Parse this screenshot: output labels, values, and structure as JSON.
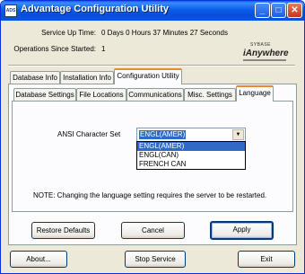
{
  "window": {
    "title": "Advantage Configuration Utility",
    "icon_text": "ADS",
    "controls": {
      "minimize": "_",
      "maximize": "□",
      "close": "✕"
    }
  },
  "status": {
    "uptime_label": "Service Up Time:",
    "uptime_value": "0 Days 0 Hours 37 Minutes 27 Seconds",
    "ops_label": "Operations Since Started:",
    "ops_value": "1"
  },
  "logo": {
    "small": "SYBASE",
    "big": "iAnywhere"
  },
  "main_tabs": [
    "Database Info",
    "Installation Info",
    "Configuration Utility"
  ],
  "sub_tabs": [
    "Database Settings",
    "File Locations",
    "Communications",
    "Misc. Settings",
    "Language"
  ],
  "language": {
    "field_label": "ANSI Character Set",
    "selected": "ENGL(AMER)",
    "options": [
      "ENGL(AMER)",
      "ENGL(CAN)",
      "FRENCH CAN"
    ],
    "note": "NOTE: Changing the language setting requires the server to be restarted."
  },
  "buttons": {
    "restore_defaults": "Restore Defaults",
    "cancel": "Cancel",
    "apply": "Apply",
    "about": "About...",
    "stop_service": "Stop Service",
    "exit": "Exit"
  }
}
